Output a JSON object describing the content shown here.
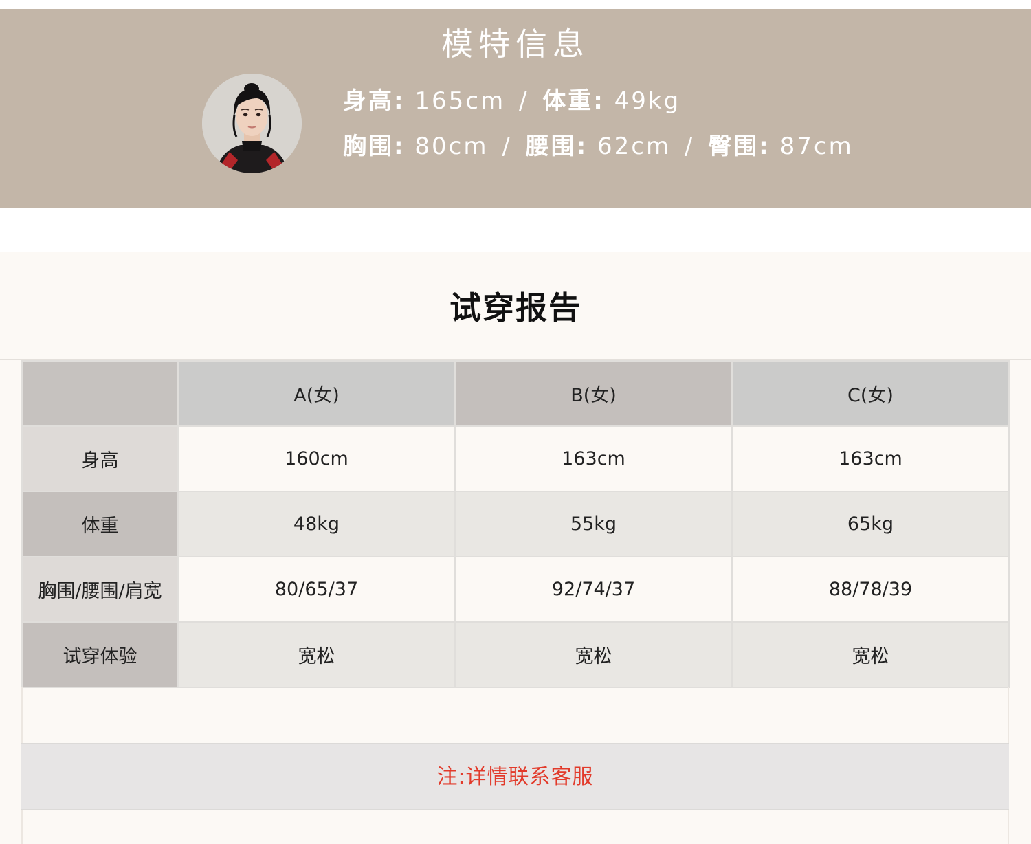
{
  "model_info": {
    "title": "模特信息",
    "line1": {
      "height_label": "身高:",
      "height_value": "165cm",
      "sep": "/",
      "weight_label": "体重:",
      "weight_value": "49kg"
    },
    "line2": {
      "bust_label": "胸围:",
      "bust_value": "80cm",
      "sep1": "/",
      "waist_label": "腰围:",
      "waist_value": "62cm",
      "sep2": "/",
      "hip_label": "臀围:",
      "hip_value": "87cm"
    }
  },
  "fit_report": {
    "title": "试穿报告",
    "columns": [
      "A(女)",
      "B(女)",
      "C(女)"
    ],
    "rows": [
      {
        "label": "身高",
        "values": [
          "160cm",
          "163cm",
          "163cm"
        ]
      },
      {
        "label": "体重",
        "values": [
          "48kg",
          "55kg",
          "65kg"
        ]
      },
      {
        "label": "胸围/腰围/肩宽",
        "values": [
          "80/65/37",
          "92/74/37",
          "88/78/39"
        ]
      },
      {
        "label": "试穿体验",
        "values": [
          "宽松",
          "宽松",
          "宽松"
        ]
      }
    ],
    "note": "注:详情联系客服"
  },
  "colors": {
    "banner": "#c3b6a8",
    "note_text": "#e23a2a"
  }
}
